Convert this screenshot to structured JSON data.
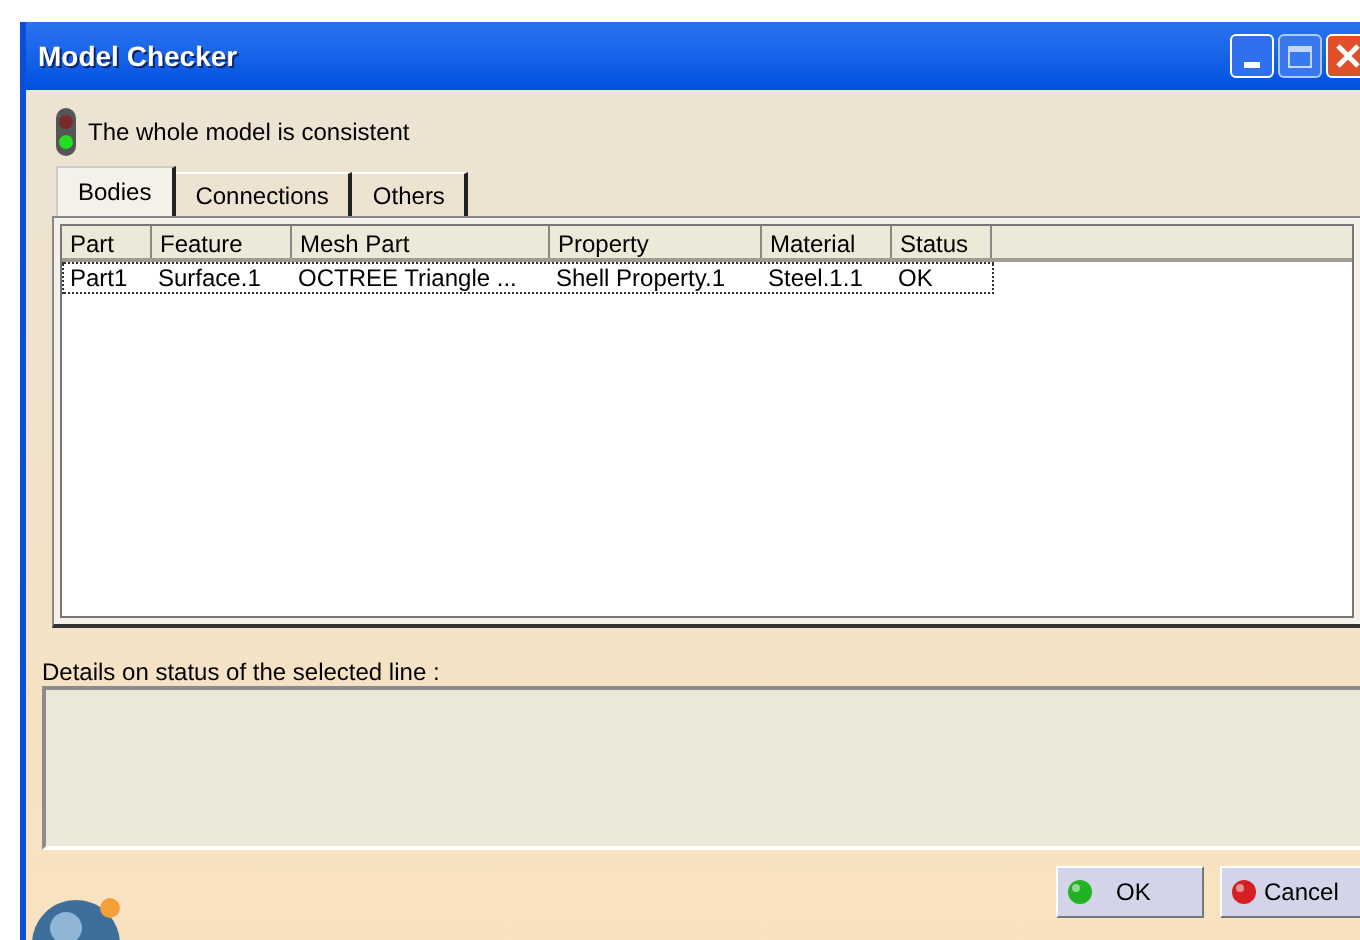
{
  "window": {
    "title": "Model Checker"
  },
  "status": {
    "text": "The whole model is consistent",
    "consistent": true
  },
  "tabs": [
    {
      "label": "Bodies",
      "selected": true
    },
    {
      "label": "Connections",
      "selected": false
    },
    {
      "label": "Others",
      "selected": false
    }
  ],
  "table": {
    "columns": [
      "Part",
      "Feature",
      "Mesh Part",
      "Property",
      "Material",
      "Status"
    ],
    "rows": [
      {
        "cells": [
          "Part1",
          "Surface.1",
          "OCTREE Triangle ...",
          "Shell Property.1",
          "Steel.1.1",
          "OK"
        ],
        "selected": true
      }
    ]
  },
  "details": {
    "label": "Details on status of the selected line :"
  },
  "buttons": [
    {
      "label": "OK",
      "kind": "ok"
    },
    {
      "label": "Cancel",
      "kind": "cancel"
    }
  ]
}
